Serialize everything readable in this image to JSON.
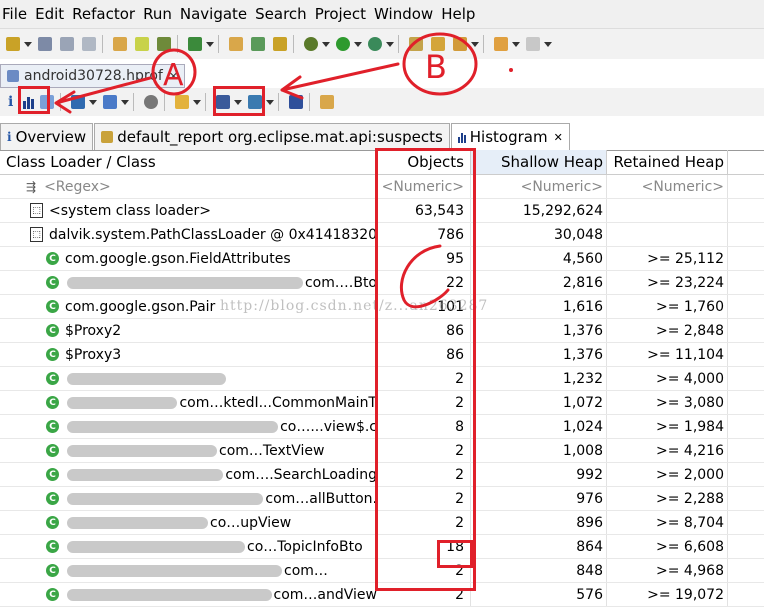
{
  "menu": [
    "File",
    "Edit",
    "Refactor",
    "Run",
    "Navigate",
    "Search",
    "Project",
    "Window",
    "Help"
  ],
  "file_tab": {
    "label": "android30728.hprof",
    "close": "✕"
  },
  "tabs": [
    {
      "label": "Overview",
      "icon": "i"
    },
    {
      "label": "default_report  org.eclipse.mat.api:suspects",
      "icon": "db"
    },
    {
      "label": "Histogram",
      "icon": "bars",
      "close": "✕"
    }
  ],
  "columns": [
    "Class Loader / Class",
    "Objects",
    "Shallow Heap",
    "Retained Heap"
  ],
  "regex_row": {
    "label": "<Regex>",
    "num1": "<Numeric>",
    "num2": "<Numeric>",
    "num3": "<Numeric>"
  },
  "rows": [
    {
      "name": "<system class loader>",
      "objects": "63,543",
      "shallow": "15,292,624",
      "retained": "",
      "kind": "loader",
      "indent": 1
    },
    {
      "name": "dalvik.system.PathClassLoader @ 0x41418320",
      "objects": "786",
      "shallow": "30,048",
      "retained": "",
      "kind": "loader",
      "indent": 1
    },
    {
      "name": "com.google.gson.FieldAttributes",
      "objects": "95",
      "shallow": "4,560",
      "retained": ">= 25,112",
      "kind": "class"
    },
    {
      "name": "com.…Bto",
      "objects": "22",
      "shallow": "2,816",
      "retained": ">= 23,224",
      "kind": "class",
      "blur": true
    },
    {
      "name": "com.google.gson.Pair",
      "objects": "101",
      "shallow": "1,616",
      "retained": ">= 1,760",
      "kind": "class"
    },
    {
      "name": "$Proxy2",
      "objects": "86",
      "shallow": "1,376",
      "retained": ">= 2,848",
      "kind": "class"
    },
    {
      "name": "$Proxy3",
      "objects": "86",
      "shallow": "1,376",
      "retained": ">= 11,104",
      "kind": "class"
    },
    {
      "name": "",
      "objects": "2",
      "shallow": "1,232",
      "retained": ">= 4,000",
      "kind": "class",
      "blur": true
    },
    {
      "name": "com…ktedI...CommonMainT",
      "objects": "2",
      "shallow": "1,072",
      "retained": ">= 3,080",
      "kind": "class",
      "blur": true
    },
    {
      "name": "co…...view$.c",
      "objects": "8",
      "shallow": "1,024",
      "retained": ">= 1,984",
      "kind": "class",
      "blur": true
    },
    {
      "name": "com…TextView",
      "objects": "2",
      "shallow": "1,008",
      "retained": ">= 4,216",
      "kind": "class",
      "blur": true
    },
    {
      "name": "com….SearchLoading",
      "objects": "2",
      "shallow": "992",
      "retained": ">= 2,000",
      "kind": "class",
      "blur": true
    },
    {
      "name": "com…allButton.",
      "objects": "2",
      "shallow": "976",
      "retained": ">= 2,288",
      "kind": "class",
      "blur": true
    },
    {
      "name": "co…upView",
      "objects": "2",
      "shallow": "896",
      "retained": ">= 8,704",
      "kind": "class",
      "blur": true
    },
    {
      "name": "co…TopicInfoBto",
      "objects": "18",
      "shallow": "864",
      "retained": ">= 6,608",
      "kind": "class",
      "blur": true
    },
    {
      "name": "com…",
      "objects": "2",
      "shallow": "848",
      "retained": ">= 4,968",
      "kind": "class",
      "blur": true
    },
    {
      "name": "com…andView",
      "objects": "2",
      "shallow": "576",
      "retained": ">= 19,072",
      "kind": "class",
      "blur": true
    }
  ],
  "watermark": "http://blog.csdn.net/z...an263287",
  "annotations": {
    "label_a": "A",
    "label_b": "B",
    "accent": "#e0202a"
  }
}
